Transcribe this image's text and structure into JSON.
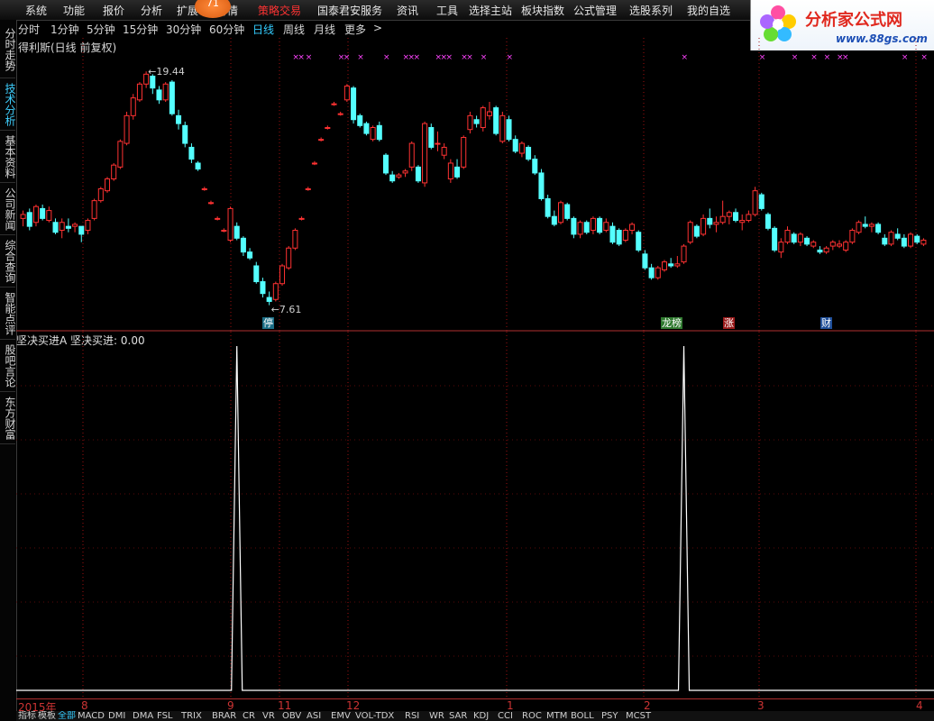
{
  "menu": [
    "系统",
    "功能",
    "报价",
    "分析",
    "扩展",
    "行情",
    "策略交易",
    "国泰君安服务",
    "资讯",
    "工具",
    "选择主站",
    "板块指数",
    "公式管理",
    "选股系列",
    "我的自选"
  ],
  "menu_highlight_index": 6,
  "badge_value": "71",
  "logo": {
    "text": "分析家公式网",
    "url": "www.88gs.com"
  },
  "left_tabs": [
    {
      "label": "分时走势",
      "active": false
    },
    {
      "label": "技术分析",
      "active": true
    },
    {
      "label": "基本资料",
      "active": false
    },
    {
      "label": "公司新闻",
      "active": false
    },
    {
      "label": "综合查询",
      "active": false
    },
    {
      "label": "智能点评",
      "active": false
    },
    {
      "label": "股吧言论",
      "active": false
    },
    {
      "label": "东方财富",
      "active": false
    }
  ],
  "periods": [
    "分时",
    "1分钟",
    "5分钟",
    "15分钟",
    "30分钟",
    "60分钟",
    "日线",
    "周线",
    "月线",
    "更多"
  ],
  "active_period": "日线",
  "more_arrow": ">",
  "chart_title": "得利斯(日线 前复权)",
  "extremes": {
    "high": "19.44",
    "low": "7.61"
  },
  "tags": {
    "stop": "停",
    "list": "龙榜",
    "up": "涨",
    "fin": "财"
  },
  "indicator": {
    "name": "坚决买进A",
    "line_label": "坚决买进:",
    "value": "0.00"
  },
  "date_axis": [
    "2015年",
    "8",
    "9",
    "11",
    "12",
    "1",
    "2",
    "3",
    "4"
  ],
  "bottom_tabs": [
    "指标",
    "模板",
    "全部",
    "MACD",
    "DMI",
    "DMA",
    "FSL",
    "TRIX",
    "BRAR",
    "CR",
    "VR",
    "OBV",
    "ASI",
    "EMV",
    "VOL-TDX",
    "RSI",
    "WR",
    "SAR",
    "KDJ",
    "CCI",
    "ROC",
    "MTM",
    "BOLL",
    "PSY",
    "MCST"
  ],
  "active_bottom_tab": "全部",
  "colors": {
    "up": "#ff3232",
    "down": "#54ffff",
    "signal": "#ff44ff",
    "grid": "#a01010",
    "line": "#ffffff"
  },
  "chart_data": [
    {
      "type": "candlestick",
      "title": "得利斯(日线 前复权)",
      "ylim": [
        7.0,
        20.5
      ],
      "candles": [
        [
          12.0,
          12.4,
          11.6,
          12.2
        ],
        [
          12.3,
          12.5,
          11.4,
          11.6
        ],
        [
          11.8,
          12.7,
          11.6,
          12.6
        ],
        [
          12.5,
          12.7,
          11.9,
          12.0
        ],
        [
          11.9,
          12.6,
          11.8,
          12.4
        ],
        [
          11.8,
          12.0,
          11.2,
          11.3
        ],
        [
          11.4,
          12.0,
          11.0,
          11.8
        ],
        [
          11.6,
          12.0,
          11.3,
          11.5
        ],
        [
          11.6,
          11.8,
          11.3,
          11.7
        ],
        [
          11.6,
          11.6,
          10.8,
          11.2
        ],
        [
          11.4,
          12.0,
          11.2,
          11.9
        ],
        [
          12.0,
          13.0,
          11.9,
          12.9
        ],
        [
          12.9,
          13.6,
          12.8,
          13.5
        ],
        [
          13.4,
          14.1,
          13.3,
          14.0
        ],
        [
          14.0,
          14.8,
          13.9,
          14.7
        ],
        [
          14.6,
          16.0,
          14.5,
          15.9
        ],
        [
          15.8,
          17.4,
          15.7,
          17.2
        ],
        [
          17.2,
          18.3,
          17.0,
          18.1
        ],
        [
          18.0,
          18.9,
          17.9,
          18.8
        ],
        [
          18.8,
          19.44,
          18.6,
          19.3
        ],
        [
          19.2,
          19.3,
          18.3,
          18.6
        ],
        [
          18.5,
          18.7,
          17.8,
          18.0
        ],
        [
          18.0,
          18.9,
          17.9,
          18.8
        ],
        [
          18.9,
          19.0,
          17.2,
          17.3
        ],
        [
          17.2,
          17.5,
          16.5,
          16.8
        ],
        [
          16.7,
          16.9,
          15.6,
          15.8
        ],
        [
          15.6,
          15.8,
          14.8,
          15.0
        ],
        [
          14.8,
          14.9,
          14.4,
          14.5
        ],
        [
          13.5,
          13.6,
          13.4,
          13.5
        ],
        [
          12.8,
          12.9,
          12.7,
          12.8
        ],
        [
          12.0,
          12.1,
          11.9,
          12.0
        ],
        [
          11.4,
          11.5,
          11.3,
          11.4
        ],
        [
          10.9,
          12.6,
          10.8,
          12.5
        ],
        [
          11.6,
          11.8,
          10.9,
          11.0
        ],
        [
          11.0,
          11.1,
          10.1,
          10.3
        ],
        [
          10.3,
          10.5,
          9.9,
          10.0
        ],
        [
          9.6,
          9.8,
          8.7,
          8.8
        ],
        [
          8.8,
          9.0,
          8.0,
          8.2
        ],
        [
          8.0,
          8.3,
          7.61,
          7.8
        ],
        [
          7.9,
          8.8,
          7.8,
          8.7
        ],
        [
          8.7,
          9.7,
          8.6,
          9.6
        ],
        [
          9.5,
          10.6,
          9.4,
          10.5
        ],
        [
          10.5,
          11.5,
          10.4,
          11.4
        ],
        [
          12.0,
          12.1,
          11.9,
          12.0
        ],
        [
          13.5,
          13.6,
          13.4,
          13.5
        ],
        [
          14.8,
          14.9,
          14.7,
          14.8
        ],
        [
          16.0,
          16.1,
          15.9,
          16.0
        ],
        [
          16.6,
          16.7,
          16.5,
          16.6
        ],
        [
          17.8,
          17.9,
          17.7,
          17.8
        ],
        [
          17.3,
          17.4,
          17.2,
          17.3
        ],
        [
          18.0,
          18.8,
          17.9,
          18.7
        ],
        [
          18.6,
          18.7,
          16.8,
          17.0
        ],
        [
          17.2,
          17.3,
          16.6,
          16.7
        ],
        [
          16.8,
          16.9,
          16.2,
          16.3
        ],
        [
          16.0,
          16.7,
          15.9,
          16.6
        ],
        [
          16.7,
          16.9,
          15.9,
          16.0
        ],
        [
          15.2,
          15.3,
          14.2,
          14.3
        ],
        [
          14.2,
          14.4,
          13.8,
          13.9
        ],
        [
          14.1,
          14.3,
          14.0,
          14.2
        ],
        [
          14.3,
          14.5,
          14.1,
          14.4
        ],
        [
          14.6,
          15.9,
          14.4,
          15.8
        ],
        [
          14.6,
          14.7,
          13.8,
          13.9
        ],
        [
          13.8,
          16.9,
          13.6,
          16.8
        ],
        [
          16.6,
          16.8,
          15.5,
          15.6
        ],
        [
          15.8,
          16.4,
          15.4,
          15.8
        ],
        [
          15.2,
          15.8,
          15.0,
          15.6
        ],
        [
          14.0,
          15.0,
          13.8,
          14.8
        ],
        [
          14.6,
          15.0,
          14.0,
          14.1
        ],
        [
          14.6,
          16.2,
          14.5,
          16.1
        ],
        [
          16.5,
          17.4,
          16.3,
          17.2
        ],
        [
          17.0,
          17.2,
          16.6,
          16.8
        ],
        [
          16.6,
          17.7,
          16.4,
          17.6
        ],
        [
          17.2,
          17.9,
          17.0,
          17.4
        ],
        [
          17.6,
          17.7,
          16.2,
          16.3
        ],
        [
          15.9,
          17.4,
          15.8,
          17.2
        ],
        [
          17.0,
          17.2,
          15.9,
          16.0
        ],
        [
          16.0,
          16.2,
          15.3,
          15.4
        ],
        [
          15.3,
          15.9,
          15.1,
          15.8
        ],
        [
          15.6,
          15.7,
          14.9,
          15.0
        ],
        [
          15.0,
          15.2,
          14.2,
          14.3
        ],
        [
          14.3,
          14.5,
          12.9,
          13.0
        ],
        [
          13.0,
          13.2,
          12.0,
          12.1
        ],
        [
          12.1,
          12.4,
          11.6,
          11.7
        ],
        [
          11.8,
          12.9,
          11.7,
          12.8
        ],
        [
          12.7,
          12.8,
          11.9,
          12.0
        ],
        [
          12.0,
          12.1,
          11.0,
          11.2
        ],
        [
          11.2,
          11.9,
          11.0,
          11.8
        ],
        [
          11.8,
          11.9,
          11.2,
          11.3
        ],
        [
          11.4,
          12.1,
          11.2,
          12.0
        ],
        [
          12.0,
          12.1,
          11.2,
          11.3
        ],
        [
          11.4,
          12.0,
          11.3,
          11.8
        ],
        [
          11.6,
          11.8,
          10.7,
          10.8
        ],
        [
          11.4,
          11.5,
          10.6,
          10.7
        ],
        [
          10.9,
          11.5,
          10.8,
          11.4
        ],
        [
          11.4,
          11.8,
          11.2,
          11.7
        ],
        [
          11.3,
          11.4,
          10.3,
          10.4
        ],
        [
          10.2,
          10.4,
          9.4,
          9.5
        ],
        [
          9.5,
          9.7,
          8.9,
          9.0
        ],
        [
          9.0,
          9.6,
          8.9,
          9.5
        ],
        [
          9.4,
          9.9,
          9.3,
          9.8
        ],
        [
          9.7,
          10.0,
          9.5,
          9.6
        ],
        [
          9.6,
          10.1,
          9.5,
          9.7
        ],
        [
          9.8,
          10.7,
          9.7,
          10.6
        ],
        [
          10.8,
          11.9,
          10.7,
          11.8
        ],
        [
          11.6,
          11.7,
          11.0,
          11.1
        ],
        [
          11.2,
          12.2,
          11.1,
          12.0
        ],
        [
          12.0,
          12.5,
          11.5,
          11.7
        ],
        [
          11.7,
          12.1,
          11.3,
          11.8
        ],
        [
          11.8,
          12.9,
          11.7,
          12.1
        ],
        [
          12.1,
          12.4,
          11.7,
          12.3
        ],
        [
          12.3,
          12.5,
          11.8,
          11.9
        ],
        [
          11.8,
          12.2,
          11.4,
          11.9
        ],
        [
          11.9,
          12.4,
          11.8,
          12.2
        ],
        [
          12.2,
          13.6,
          12.1,
          13.4
        ],
        [
          13.2,
          13.3,
          12.4,
          12.5
        ],
        [
          12.2,
          12.3,
          11.4,
          11.5
        ],
        [
          11.5,
          11.6,
          10.3,
          10.4
        ],
        [
          10.3,
          11.0,
          10.0,
          10.8
        ],
        [
          10.8,
          11.6,
          10.7,
          11.4
        ],
        [
          11.2,
          11.3,
          10.7,
          10.8
        ],
        [
          10.8,
          11.3,
          10.6,
          11.2
        ],
        [
          11.0,
          11.1,
          10.6,
          10.7
        ],
        [
          10.6,
          10.9,
          10.5,
          10.8
        ],
        [
          10.4,
          10.6,
          10.2,
          10.3
        ],
        [
          10.3,
          10.6,
          10.2,
          10.5
        ],
        [
          10.6,
          10.9,
          10.4,
          10.8
        ],
        [
          10.6,
          10.9,
          10.5,
          10.7
        ],
        [
          10.4,
          10.9,
          10.3,
          10.8
        ],
        [
          10.8,
          11.5,
          10.7,
          11.4
        ],
        [
          11.3,
          11.9,
          11.2,
          11.8
        ],
        [
          11.7,
          12.1,
          11.5,
          11.6
        ],
        [
          11.6,
          11.8,
          11.3,
          11.7
        ],
        [
          11.7,
          11.8,
          11.2,
          11.3
        ],
        [
          11.0,
          11.2,
          10.6,
          10.7
        ],
        [
          10.7,
          11.4,
          10.6,
          11.3
        ],
        [
          11.2,
          11.5,
          10.9,
          11.0
        ],
        [
          11.0,
          11.2,
          10.5,
          10.6
        ],
        [
          10.6,
          11.3,
          10.5,
          11.2
        ],
        [
          11.1,
          11.2,
          10.7,
          10.8
        ],
        [
          10.7,
          11.0,
          10.6,
          10.9
        ]
      ],
      "signals": [
        {
          "index": 42,
          "count": 2
        },
        {
          "index": 44,
          "count": 1
        },
        {
          "index": 49,
          "count": 2
        },
        {
          "index": 52,
          "count": 1
        },
        {
          "index": 56,
          "count": 1
        },
        {
          "index": 59,
          "count": 3
        },
        {
          "index": 64,
          "count": 3
        },
        {
          "index": 68,
          "count": 2
        },
        {
          "index": 71,
          "count": 1
        },
        {
          "index": 75,
          "count": 1
        },
        {
          "index": 102,
          "count": 1
        },
        {
          "index": 114,
          "count": 1
        },
        {
          "index": 119,
          "count": 1
        },
        {
          "index": 122,
          "count": 1
        },
        {
          "index": 124,
          "count": 1
        },
        {
          "index": 126,
          "count": 2
        },
        {
          "index": 136,
          "count": 1
        },
        {
          "index": 139,
          "count": 1
        }
      ]
    },
    {
      "type": "line",
      "title": "坚决买进A",
      "series": [
        {
          "name": "坚决买进",
          "spikes": [
            33,
            102
          ],
          "spike_value": 1,
          "baseline": 0
        }
      ],
      "ylim": [
        0,
        1
      ]
    }
  ]
}
